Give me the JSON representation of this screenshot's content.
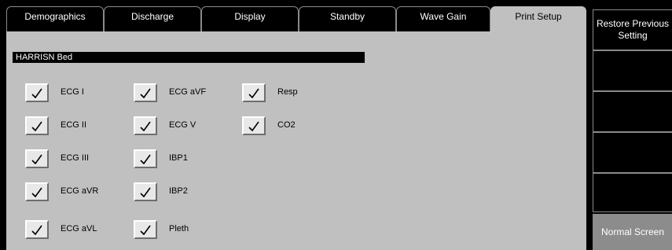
{
  "tabs": [
    {
      "label": "Demographics",
      "active": false
    },
    {
      "label": "Discharge",
      "active": false
    },
    {
      "label": "Display",
      "active": false
    },
    {
      "label": "Standby",
      "active": false
    },
    {
      "label": "Wave Gain",
      "active": false
    },
    {
      "label": "Print Setup",
      "active": true
    }
  ],
  "bed_label": "HARRISN Bed",
  "options": {
    "col1": [
      {
        "label": "ECG I",
        "checked": true
      },
      {
        "label": "ECG II",
        "checked": true
      },
      {
        "label": "ECG III",
        "checked": true
      },
      {
        "label": "ECG aVR",
        "checked": true
      },
      {
        "label": "ECG aVL",
        "checked": true
      }
    ],
    "col2": [
      {
        "label": "ECG aVF",
        "checked": true
      },
      {
        "label": "ECG V",
        "checked": true
      },
      {
        "label": "IBP1",
        "checked": true
      },
      {
        "label": "IBP2",
        "checked": true
      },
      {
        "label": "Pleth",
        "checked": true
      }
    ],
    "col3": [
      {
        "label": "Resp",
        "checked": true
      },
      {
        "label": "CO2",
        "checked": true
      }
    ]
  },
  "side_buttons": [
    {
      "label": "Restore Previous Setting"
    },
    {
      "label": ""
    },
    {
      "label": ""
    },
    {
      "label": ""
    },
    {
      "label": ""
    },
    {
      "label": "Normal Screen"
    }
  ],
  "colors": {
    "panel": "#c0c0c0",
    "background": "#000000",
    "normal_screen_button": "#8c8c8c"
  }
}
